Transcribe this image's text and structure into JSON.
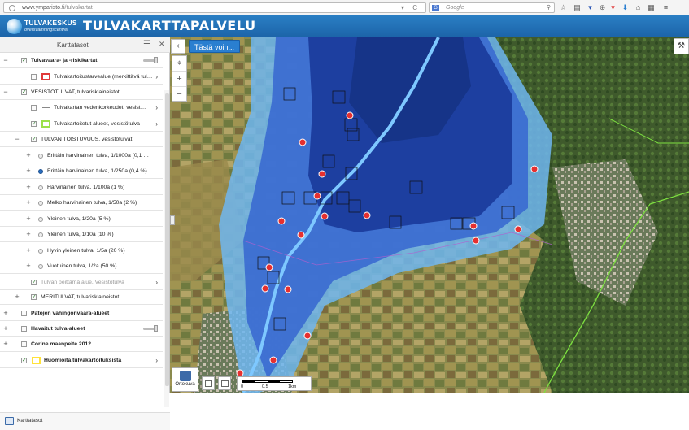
{
  "browser": {
    "url_host": "www.ymparisto.fi",
    "url_path": "/tulvakartat",
    "search_placeholder": "Google",
    "search_engine_letter": "G",
    "nav_glyphs": "▾ C",
    "search_glyph": "⚲",
    "toolbar": [
      "☆",
      "▤",
      "▾",
      "⊕",
      "▾",
      "⬇",
      "⌂",
      "▦",
      "≡"
    ]
  },
  "header": {
    "logo_main": "TULVAKESKUS",
    "logo_sub": "översvämningscentret",
    "title": "TULVAKARTTAPALVELU"
  },
  "sidebar": {
    "title": "Karttatasot",
    "menu_glyph": "☰",
    "close_glyph": "✕",
    "footer_label": "Karttatasot",
    "rows": [
      {
        "exp": "−",
        "label": "Tulvavaara- ja -riskikartat",
        "bold": true,
        "checked": true,
        "slider": true
      },
      {
        "label": "Tulvakartoitustarvealue (merkittävä tul…",
        "checked": false,
        "swatch": "#e03a3a",
        "arrow": "›"
      },
      {
        "exp": "−",
        "label": "VESISTÖTULVAT, tulvariskiaineistot",
        "checked": true
      },
      {
        "label": "Tulvakartan vedenkorkeudet, vesist…",
        "checked": false,
        "line": true,
        "arrow": "›"
      },
      {
        "label": "Tulvakartoitetut alueet, vesistötulva",
        "checked": true,
        "swatch": "#9be04a",
        "arrow": "›"
      },
      {
        "exp": "−",
        "label": "TULVAN TOISTUVUUS, vesistötulvat",
        "checked": true
      },
      {
        "exp": "+",
        "label": "Erittäin harvinainen tulva, 1/1000a (0,1 …",
        "radio": false
      },
      {
        "exp": "+",
        "label": "Erittäin harvinainen tulva, 1/250a (0,4 %)",
        "radio": true
      },
      {
        "exp": "+",
        "label": "Harvinainen tulva, 1/100a (1 %)",
        "radio": false
      },
      {
        "exp": "+",
        "label": "Melko harvinainen tulva, 1/50a (2 %)",
        "radio": false
      },
      {
        "exp": "+",
        "label": "Yleinen tulva, 1/20a (5 %)",
        "radio": false
      },
      {
        "exp": "+",
        "label": "Yleinen tulva, 1/10a (10 %)",
        "radio": false
      },
      {
        "exp": "+",
        "label": "Hyvin yleinen tulva, 1/5a (20 %)",
        "radio": false
      },
      {
        "exp": "+",
        "label": "Vuotuinen tulva, 1/2a (50 %)",
        "radio": false
      },
      {
        "label": "Tulvan peittämä alue, Vesistötulva",
        "checked": true,
        "dim": true,
        "arrow": "›"
      },
      {
        "exp": "+",
        "label": "MERITULVAT, tulvariskiaineistot",
        "checked": true
      },
      {
        "exp": "+",
        "label": "Patojen vahingonvaara-alueet",
        "bold": true,
        "checked": false
      },
      {
        "exp": "+",
        "label": "Havaitut tulva-alueet",
        "bold": true,
        "checked": false,
        "slider": true
      },
      {
        "exp": "+",
        "label": "Corine maanpeite 2012",
        "bold": true,
        "checked": false
      },
      {
        "label": "Huomioita tulvakartoituksista",
        "bold": true,
        "checked": true,
        "swatch": "#ffe23a",
        "arrow": "›"
      }
    ]
  },
  "map": {
    "tasta_label": "Tästä voin...",
    "collapse_glyph": "‹",
    "locate_glyph": "⌖",
    "zoom_in": "+",
    "zoom_out": "−",
    "tools_glyph": "⚒",
    "basemap_label": "Ortokuva",
    "scale_0": "0",
    "scale_1": "0.5",
    "scale_2": "1km"
  },
  "colors": {
    "header": "#1f6cb0",
    "flood_deep": "#1a3a9a",
    "flood_mid": "#3a6ad0",
    "flood_light": "#6fb6f0",
    "river": "#7ec8ff",
    "boundary": "#7de040"
  }
}
